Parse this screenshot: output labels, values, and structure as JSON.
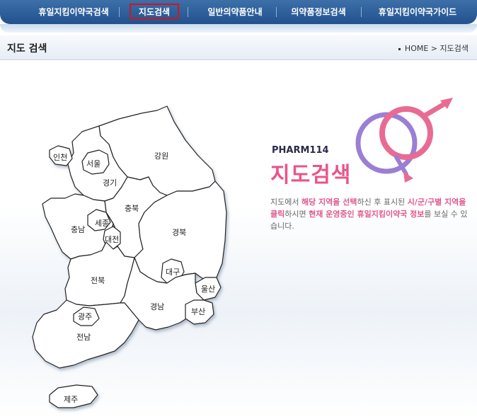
{
  "nav": {
    "items": [
      "휴일지킴이약국검색",
      "지도검색",
      "일반의약품안내",
      "의약품정보검색",
      "휴일지킴이약국가이드"
    ]
  },
  "header": {
    "title": "지도 검색",
    "breadcrumb_home": "HOME",
    "breadcrumb_sep": ">",
    "breadcrumb_current": "지도검색"
  },
  "map": {
    "regions": [
      "인천",
      "서울",
      "경기",
      "강원",
      "충북",
      "세종",
      "충남",
      "대전",
      "경북",
      "대구",
      "전북",
      "울산",
      "경남",
      "부산",
      "광주",
      "전남",
      "제주"
    ]
  },
  "promo": {
    "brand": "PHARM114",
    "headline": "지도검색",
    "desc": [
      {
        "t": "지도에서 ",
        "hl": false
      },
      {
        "t": "해당 지역을 선택",
        "hl": true
      },
      {
        "t": "하신 후 표시된 ",
        "hl": false
      },
      {
        "t": "시/군/구별 지역을 클릭",
        "hl": true
      },
      {
        "t": "하시면 ",
        "hl": false
      },
      {
        "t": "현재 운영중인 휴일지킴이약국 정보",
        "hl": true
      },
      {
        "t": "를 보실 수 있습니다.",
        "hl": false
      }
    ]
  },
  "colors": {
    "nav_bg": "#2b5c96",
    "active_outline": "#d4141c",
    "accent_pink": "#e8558a",
    "ring_purple": "#9b7fd4",
    "ring_pink": "#e86b93"
  }
}
